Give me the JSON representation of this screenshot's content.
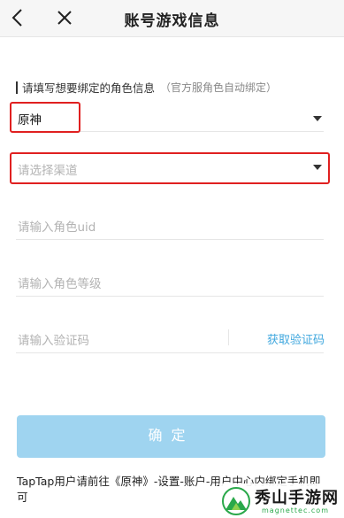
{
  "header": {
    "title": "账号游戏信息",
    "back_icon": "chevron-left-icon",
    "close_icon": "close-icon"
  },
  "form": {
    "section_label": "请填写想要绑定的角色信息",
    "section_hint": "（官方服角色自动绑定）",
    "game_value": "原神",
    "channel_placeholder": "请选择渠道",
    "uid_placeholder": "请输入角色uid",
    "level_placeholder": "请输入角色等级",
    "code_placeholder": "请输入验证码",
    "get_code_label": "获取验证码",
    "confirm_label": "确定"
  },
  "footer": {
    "note": "TapTap用户请前往《原神》-设置-账户-用户中心内绑定手机即可"
  },
  "watermark": {
    "title": "秀山手游网",
    "subtitle": "magnettec.com"
  },
  "colors": {
    "accent_link": "#3fa7de",
    "confirm_bg": "#9fd4f0",
    "highlight_border": "#e02020"
  }
}
